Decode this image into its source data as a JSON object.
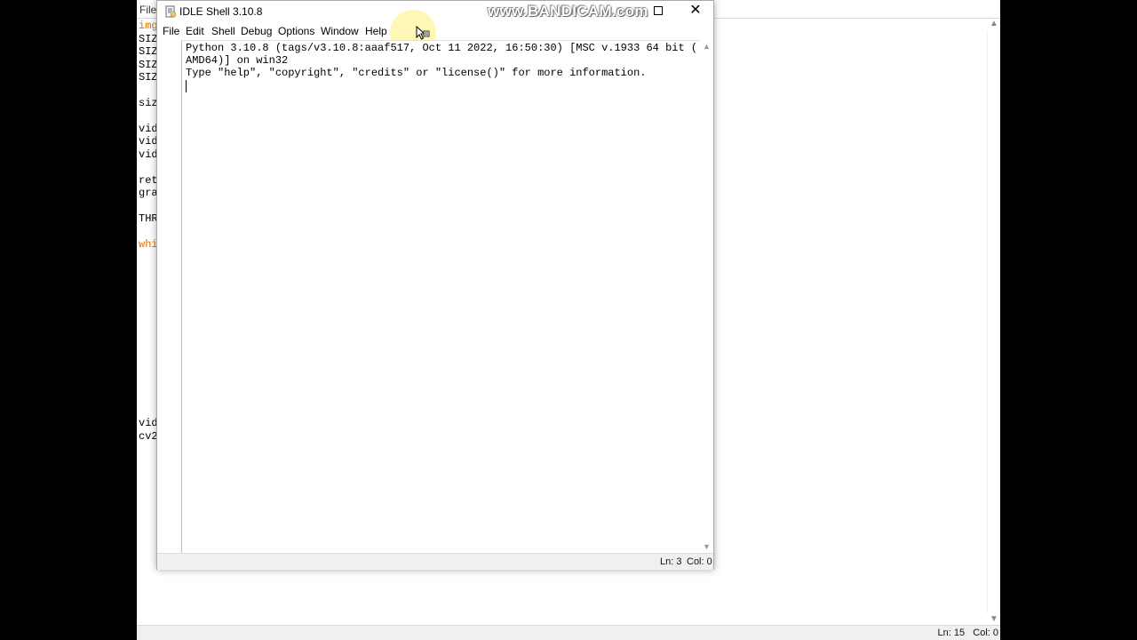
{
  "background_editor": {
    "menu_file": "File",
    "code_lines": [
      {
        "text": "img",
        "color": "orange"
      },
      {
        "text": "SIZ",
        "color": "black"
      },
      {
        "text": "SIZ",
        "color": "black"
      },
      {
        "text": "SIZ",
        "color": "black"
      },
      {
        "text": "SIZ",
        "color": "black"
      },
      {
        "text": "siz",
        "color": "black"
      },
      {
        "text": "vid",
        "color": "black"
      },
      {
        "text": "vid",
        "color": "black"
      },
      {
        "text": "vid",
        "color": "black"
      },
      {
        "text": "ret",
        "color": "black"
      },
      {
        "text": "gra",
        "color": "black"
      },
      {
        "text": "THR",
        "color": "black"
      },
      {
        "text": "whi",
        "color": "orange"
      },
      {
        "text": "vid",
        "color": "black"
      },
      {
        "text": "cv2",
        "color": "black"
      }
    ],
    "status": "Ln: 15   Col: 0"
  },
  "window": {
    "title": "IDLE Shell 3.10.8",
    "watermark": "www.BANDICAM.com",
    "close_glyph": "✕"
  },
  "menu": [
    "File",
    "Edit",
    "Shell",
    "Debug",
    "Options",
    "Window",
    "Help"
  ],
  "shell": {
    "lines": [
      "Python 3.10.8 (tags/v3.10.8:aaaf517, Oct 11 2022, 16:50:30) [MSC v.1933 64 bit (",
      "AMD64)] on win32",
      "Type \"help\", \"copyright\", \"credits\" or \"license()\" for more information."
    ]
  },
  "status": {
    "ln": "Ln: 3",
    "col": "Col: 0"
  },
  "colors": {
    "keyword_orange": "#e07000",
    "highlight_yellow": "#fff078"
  },
  "icons": {
    "title": "idle-python-icon",
    "cursor": "mouse-cursor-icon"
  }
}
